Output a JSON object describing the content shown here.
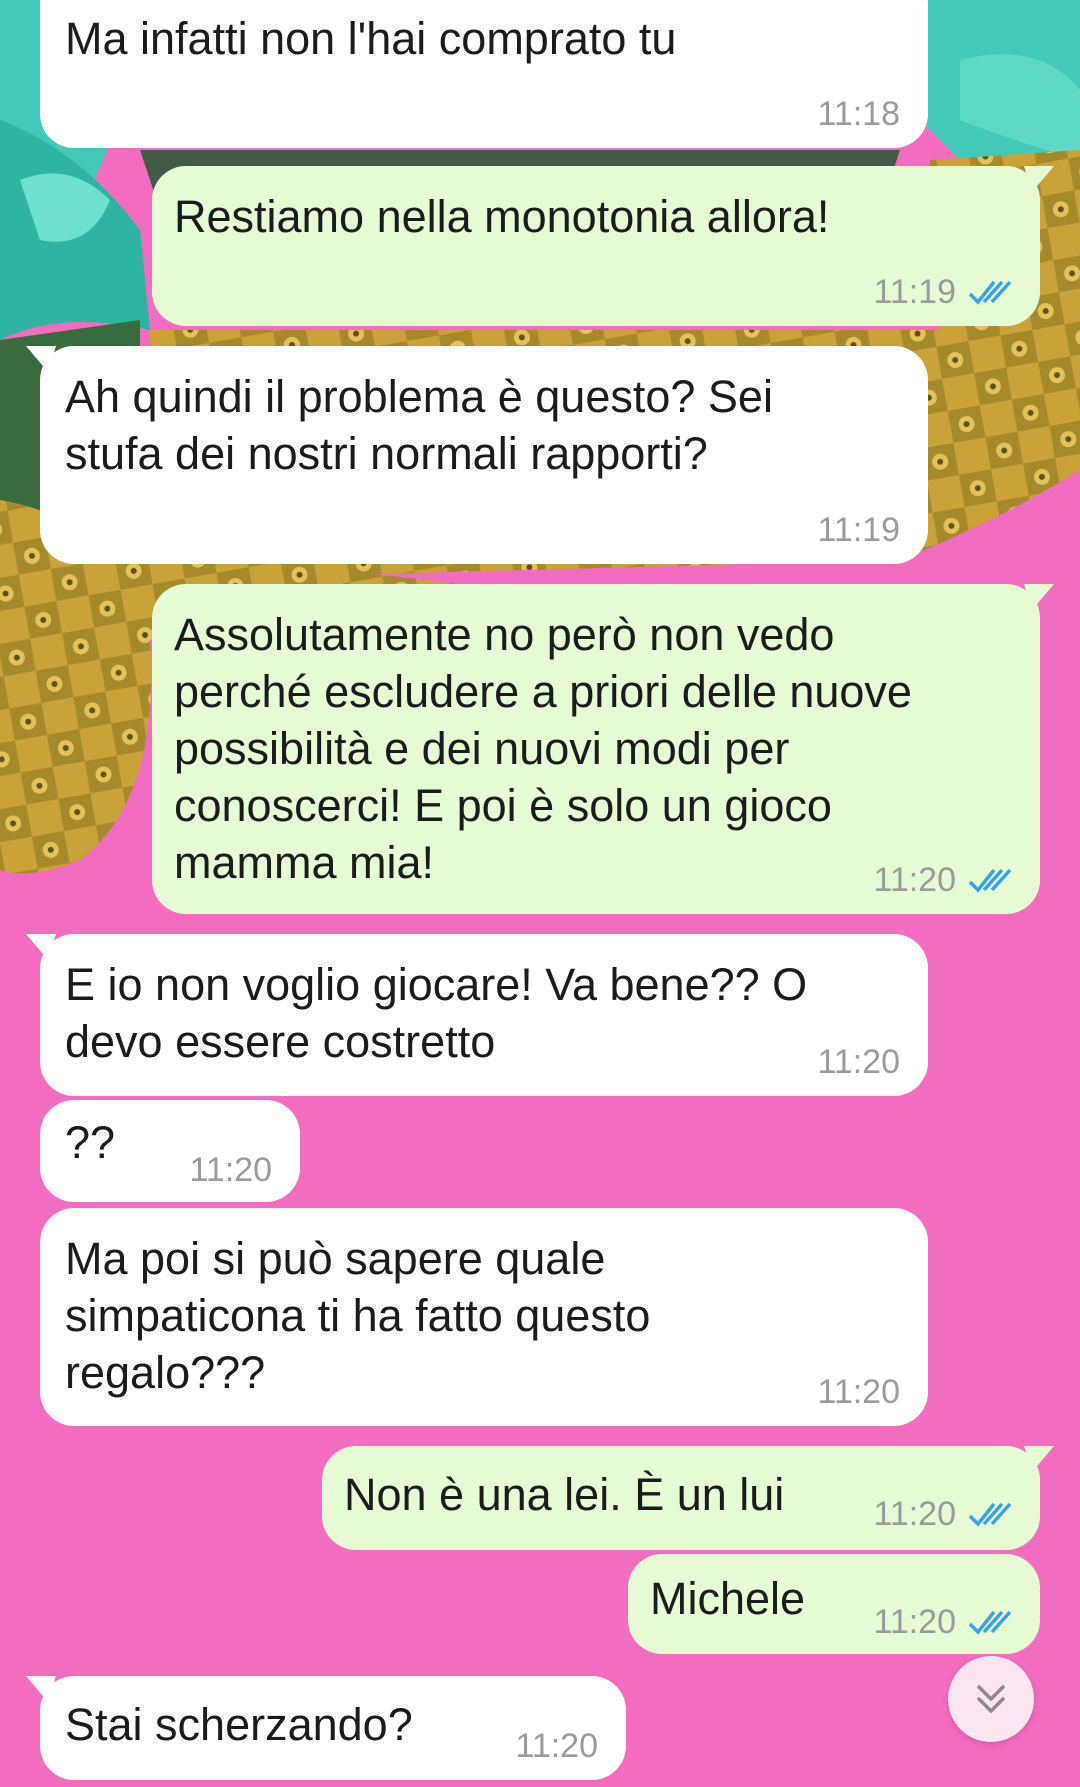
{
  "wallpaper": {
    "primary_color": "#f26cc0",
    "accent_colors": [
      "#3fc7b7",
      "#c9a23a",
      "#6b8e2a"
    ],
    "subject": "pineapples"
  },
  "messages": [
    {
      "direction": "incoming",
      "text": "Ma infatti non l'hai comprato tu",
      "time": "11:18"
    },
    {
      "direction": "outgoing",
      "text": "Restiamo nella monotonia allora!",
      "time": "11:19",
      "status": "read"
    },
    {
      "direction": "incoming",
      "text": "Ah quindi il problema è questo? Sei\nstufa dei nostri normali rapporti?",
      "time": "11:19"
    },
    {
      "direction": "outgoing",
      "text": "Assolutamente no però non vedo\nperché escludere a priori delle nuove\npossibilità e dei nuovi modi per\nconoscerci! E poi è solo un gioco\nmamma mia!",
      "time": "11:20",
      "status": "read"
    },
    {
      "direction": "incoming",
      "text": "E io non voglio giocare! Va bene?? O\ndevo essere costretto",
      "time": "11:20"
    },
    {
      "direction": "incoming",
      "text": "??",
      "time": "11:20"
    },
    {
      "direction": "incoming",
      "text": "Ma poi si può sapere quale\nsimpaticona ti ha fatto questo\nregalo???",
      "time": "11:20"
    },
    {
      "direction": "outgoing",
      "text": "Non è una lei. È un lui",
      "time": "11:20",
      "status": "read"
    },
    {
      "direction": "outgoing",
      "text": "Michele",
      "time": "11:20",
      "status": "read"
    },
    {
      "direction": "incoming",
      "text": "Stai scherzando?",
      "time": "11:20"
    }
  ],
  "colors": {
    "incoming_bubble": "#ffffff",
    "outgoing_bubble": "#e6fbd4",
    "read_ticks": "#3aa0e8",
    "time_text": "#9a9a9a"
  },
  "scroll_button": {
    "icon": "double-chevron-down-icon"
  }
}
